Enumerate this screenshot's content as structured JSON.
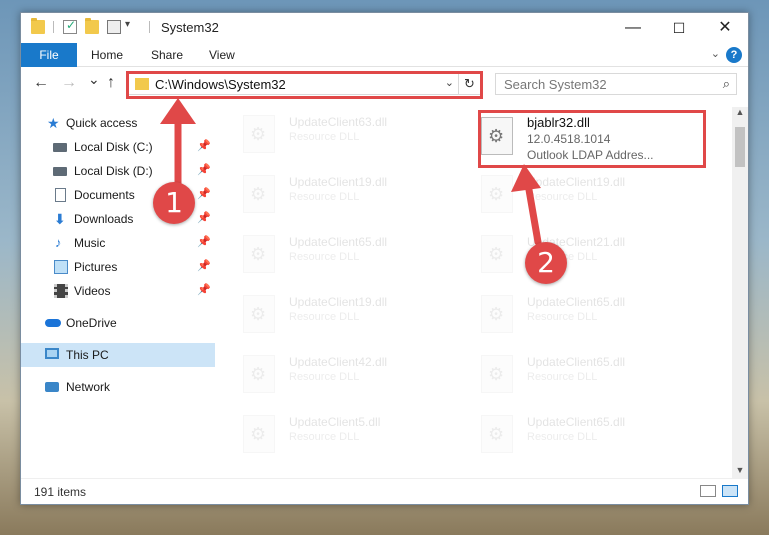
{
  "window": {
    "title": "System32",
    "controls": {
      "minimize": "—",
      "maximize": "☐",
      "close": "✕"
    }
  },
  "ribbon": {
    "tabs": [
      {
        "label": "File"
      },
      {
        "label": "Home"
      },
      {
        "label": "Share"
      },
      {
        "label": "View"
      }
    ],
    "help": "?"
  },
  "nav": {
    "back": "←",
    "forward": "→",
    "recent": "⌄",
    "up": "↑",
    "address": "C:\\Windows\\System32",
    "search_placeholder": "Search System32"
  },
  "sidebar": {
    "items": [
      {
        "label": "Quick access",
        "icon": "quick-access-star-icon"
      },
      {
        "label": "Local Disk (C:)",
        "icon": "local-disk-icon",
        "pinned": true
      },
      {
        "label": "Local Disk (D:)",
        "icon": "local-disk-icon",
        "pinned": true
      },
      {
        "label": "Documents",
        "icon": "documents-icon",
        "pinned": true
      },
      {
        "label": "Downloads",
        "icon": "downloads-icon",
        "pinned": true
      },
      {
        "label": "Music",
        "icon": "music-icon",
        "pinned": true
      },
      {
        "label": "Pictures",
        "icon": "pictures-icon",
        "pinned": true
      },
      {
        "label": "Videos",
        "icon": "videos-icon",
        "pinned": true
      },
      {
        "label": "OneDrive",
        "icon": "onedrive-icon"
      },
      {
        "label": "This PC",
        "icon": "this-pc-icon",
        "selected": true
      },
      {
        "label": "Network",
        "icon": "network-icon"
      }
    ]
  },
  "files": {
    "left_column": [
      {
        "name": "UpdateClient63.dll",
        "type": "Resource DLL"
      },
      {
        "name": "UpdateClient19.dll",
        "type": "Resource DLL"
      },
      {
        "name": "UpdateClient65.dll",
        "type": "Resource DLL"
      },
      {
        "name": "UpdateClient19.dll",
        "type": "Resource DLL"
      },
      {
        "name": "UpdateClient42.dll",
        "type": "Resource DLL"
      },
      {
        "name": "UpdateClient5.dll",
        "type": "Resource DLL"
      }
    ],
    "right_column": [
      {
        "name": "UpdateClient19.dll",
        "type": "Resource DLL"
      },
      {
        "name": "UpdateClient21.dll",
        "type": "Resource DLL"
      },
      {
        "name": "UpdateClient65.dll",
        "type": "Resource DLL"
      },
      {
        "name": "UpdateClient65.dll",
        "type": "Resource DLL"
      },
      {
        "name": "UpdateClient65.dll",
        "type": "Resource DLL"
      }
    ],
    "highlighted": {
      "name": "bjablr32.dll",
      "version": "12.0.4518.1014",
      "description": "Outlook LDAP Addres..."
    }
  },
  "status": {
    "item_count": "191 items"
  },
  "annotations": {
    "step1": "1",
    "step2": "2",
    "color": "#e04848"
  }
}
